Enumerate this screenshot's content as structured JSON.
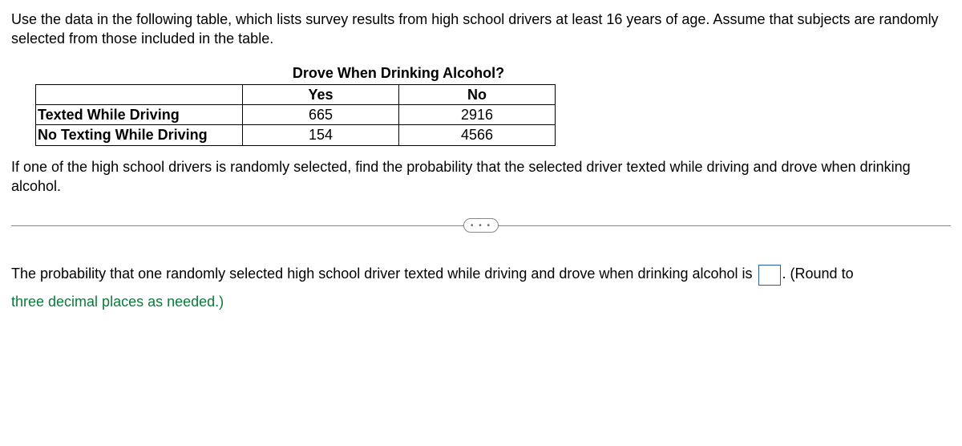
{
  "intro": "Use the data in the following table, which lists survey results from high school drivers at least 16 years of age. Assume that subjects are randomly selected from those included in the table.",
  "table": {
    "title": "Drove When Drinking Alcohol?",
    "col1": "Yes",
    "col2": "No",
    "row1": {
      "label": "Texted While Driving",
      "yes": "665",
      "no": "2916"
    },
    "row2": {
      "label": "No Texting While Driving",
      "yes": "154",
      "no": "4566"
    }
  },
  "question": "If one of the high school drivers is randomly selected, find the probability that the selected driver texted while driving and drove when drinking alcohol.",
  "answer": {
    "prefix": "The probability that one randomly selected high school driver texted while driving and drove when drinking alcohol is ",
    "suffix": ". (Round to ",
    "hint": "three decimal places as needed.)",
    "value": ""
  },
  "divider": {
    "dots": "• • •"
  }
}
